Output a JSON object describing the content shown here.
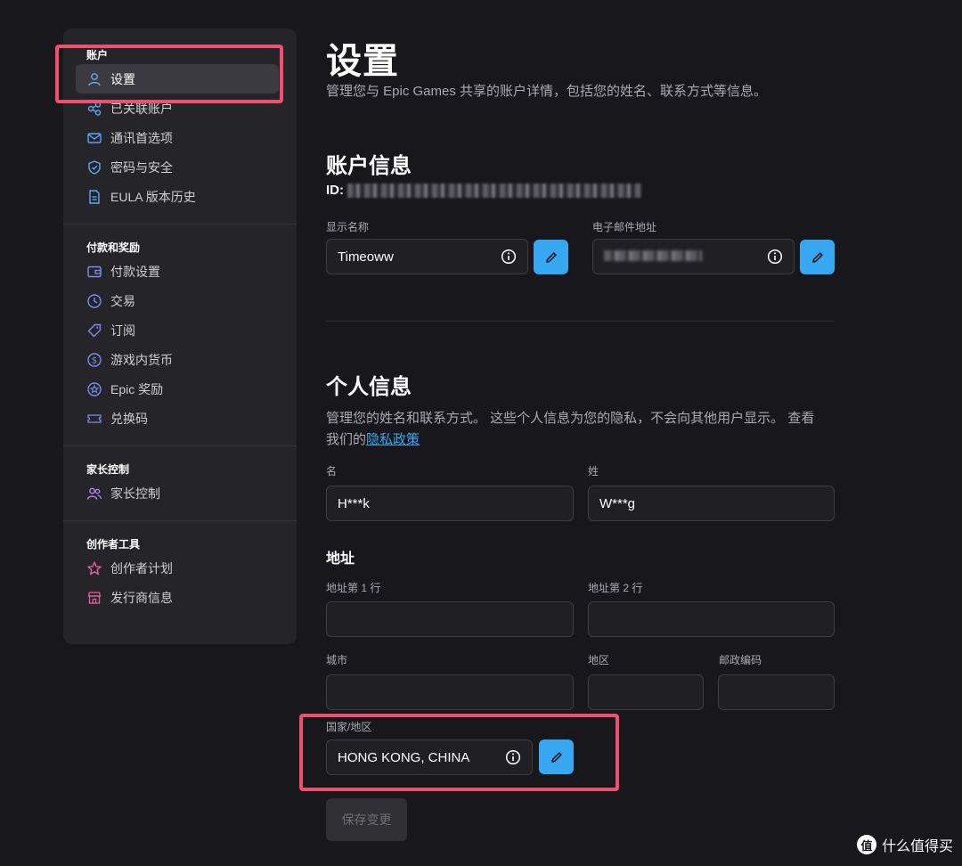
{
  "sidebar": {
    "sections": [
      {
        "heading": "账户",
        "items": [
          {
            "label": "设置",
            "icon": "user-icon"
          },
          {
            "label": "已关联账户",
            "icon": "connections-icon"
          },
          {
            "label": "通讯首选项",
            "icon": "mail-icon"
          },
          {
            "label": "密码与安全",
            "icon": "shield-icon"
          },
          {
            "label": "EULA 版本历史",
            "icon": "document-icon"
          }
        ]
      },
      {
        "heading": "付款和奖励",
        "items": [
          {
            "label": "付款设置",
            "icon": "wallet-icon"
          },
          {
            "label": "交易",
            "icon": "clock-icon"
          },
          {
            "label": "订阅",
            "icon": "tag-icon"
          },
          {
            "label": "游戏内货币",
            "icon": "dollar-icon"
          },
          {
            "label": "Epic 奖励",
            "icon": "star-badge-icon"
          },
          {
            "label": "兑换码",
            "icon": "ticket-icon"
          }
        ]
      },
      {
        "heading": "家长控制",
        "items": [
          {
            "label": "家长控制",
            "icon": "people-icon"
          }
        ]
      },
      {
        "heading": "创作者工具",
        "items": [
          {
            "label": "创作者计划",
            "icon": "star-icon"
          },
          {
            "label": "发行商信息",
            "icon": "store-icon"
          }
        ]
      }
    ]
  },
  "page": {
    "title": "设置",
    "subtitle": "管理您与 Epic Games 共享的账户详情，包括您的姓名、联系方式等信息。"
  },
  "account": {
    "title": "账户信息",
    "id_label": "ID:",
    "display_name_label": "显示名称",
    "display_name": "Timeoww",
    "email_label": "电子邮件地址"
  },
  "personal": {
    "title": "个人信息",
    "desc": "管理您的姓名和联系方式。 这些个人信息为您的隐私，不会向其他用户显示。 查看我们的",
    "privacy_link": "隐私政策",
    "first_name_label": "名",
    "first_name": "H***k",
    "last_name_label": "姓",
    "last_name": "W***g"
  },
  "address": {
    "title": "地址",
    "line1_label": "地址第 1 行",
    "line1": "",
    "line2_label": "地址第 2 行",
    "line2": "",
    "city_label": "城市",
    "city": "",
    "region_label": "地区",
    "region": "",
    "postal_label": "邮政编码",
    "postal": "",
    "country_label": "国家/地区",
    "country": "HONG KONG, CHINA"
  },
  "actions": {
    "save": "保存变更"
  },
  "watermark": {
    "text": "什么值得买",
    "logo": "值"
  },
  "colors": {
    "accent": "#37a7f2",
    "highlight": "#f0506e",
    "background": "#18171c",
    "panel": "#242429"
  }
}
